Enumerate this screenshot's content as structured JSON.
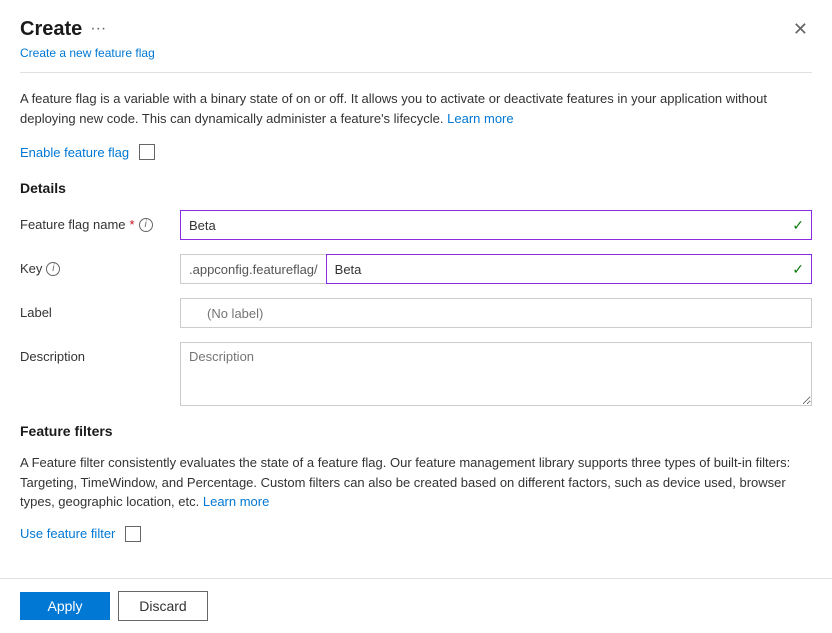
{
  "panel": {
    "title": "Create",
    "ellipsis": "···",
    "subtitle": "Create a new feature flag",
    "close_label": "✕",
    "description": "A feature flag is a variable with a binary state of on or off. It allows you to activate or deactivate features in your application without deploying new code. This can dynamically administer a feature's lifecycle.",
    "description_link": "Learn more",
    "enable_label": "Enable feature flag",
    "details_title": "Details",
    "feature_flag_name_label": "Feature flag name",
    "key_label": "Key",
    "label_label": "Label",
    "description_label": "Description",
    "feature_flag_name_value": "Beta",
    "key_prefix": ".appconfig.featureflag/",
    "key_value": "Beta",
    "label_placeholder": "(No label)",
    "description_placeholder": "Description",
    "feature_filters_title": "Feature filters",
    "filters_description": "A Feature filter consistently evaluates the state of a feature flag. Our feature management library supports three types of built-in filters: Targeting, TimeWindow, and Percentage. Custom filters can also be created based on different factors, such as device used, browser types, geographic location, etc.",
    "filters_link": "Learn more",
    "use_feature_filter_label": "Use feature filter",
    "apply_label": "Apply",
    "discard_label": "Discard"
  }
}
